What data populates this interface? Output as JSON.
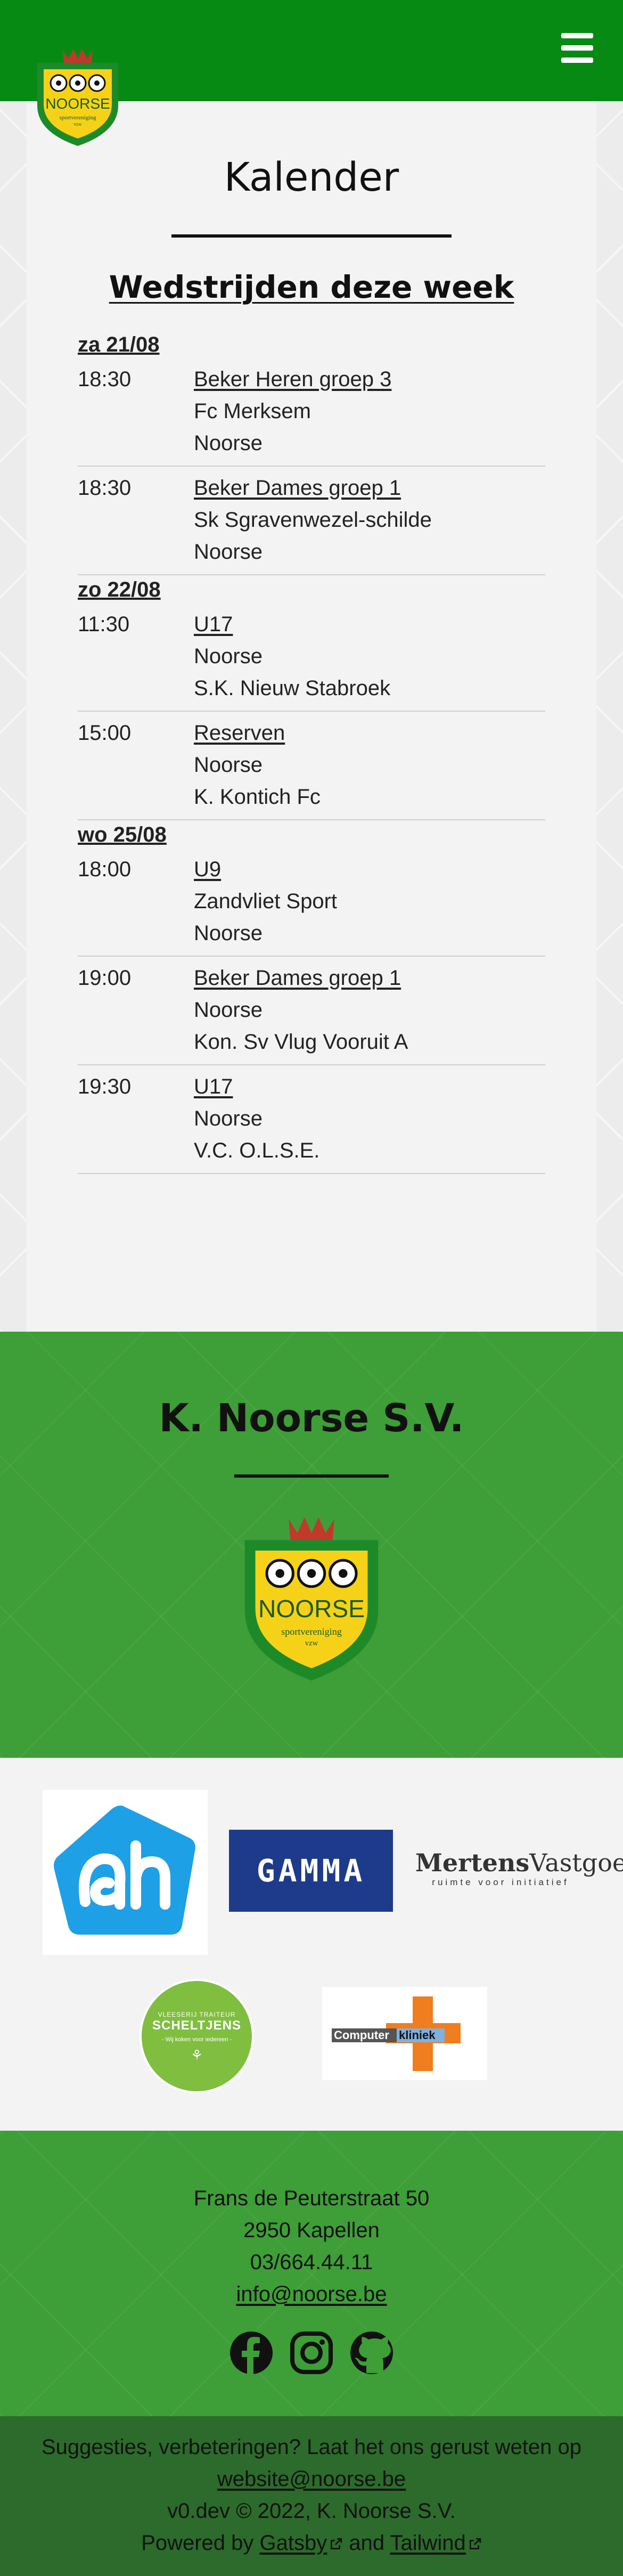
{
  "header": {
    "menu_icon": "hamburger-menu-icon",
    "logo_text": "NOORSE",
    "logo_subtext": "sportvereniging",
    "logo_subtext2": "vzw",
    "brand_color": "#078a14"
  },
  "main": {
    "title": "Kalender",
    "section_title": "Wedstrijden deze week",
    "days": [
      {
        "date": "za 21/08",
        "matches": [
          {
            "time": "18:30",
            "group": "Beker Heren groep 3",
            "home": "Fc Merksem",
            "away": "Noorse"
          },
          {
            "time": "18:30",
            "group": "Beker Dames groep 1",
            "home": "Sk Sgravenwezel-schilde",
            "away": "Noorse"
          }
        ]
      },
      {
        "date": "zo 22/08",
        "matches": [
          {
            "time": "11:30",
            "group": "U17",
            "home": "Noorse",
            "away": "S.K. Nieuw Stabroek"
          },
          {
            "time": "15:00",
            "group": "Reserven",
            "home": "Noorse",
            "away": "K. Kontich Fc"
          }
        ]
      },
      {
        "date": "wo 25/08",
        "matches": [
          {
            "time": "18:00",
            "group": "U9",
            "home": "Zandvliet Sport",
            "away": "Noorse"
          },
          {
            "time": "19:00",
            "group": "Beker Dames groep 1",
            "home": "Noorse",
            "away": "Kon. Sv Vlug Vooruit A"
          },
          {
            "time": "19:30",
            "group": "U17",
            "home": "Noorse",
            "away": "V.C. O.L.S.E."
          }
        ]
      }
    ]
  },
  "club": {
    "name": "K. Noorse S.V.",
    "logo_text": "NOORSE",
    "logo_subtext": "sportvereniging",
    "logo_subtext2": "vzw",
    "section_color": "#3e9e37"
  },
  "sponsors": {
    "gamma_label": "GAMMA",
    "mertens_bold": "Mertens",
    "mertens_rest": "Vastgoed",
    "mertens_tagline": "ruimte voor initiatief",
    "scheltjens_top": "VLEESERIJ TRAITEUR",
    "scheltjens_name": "SCHELTJENS",
    "scheltjens_tag": "- Wij koken voor iedereen -",
    "computer_label": "Computer",
    "computer_label2": "kliniek"
  },
  "contact": {
    "street": "Frans de Peuterstraat 50",
    "city": "2950 Kapellen",
    "phone": "03/664.44.11",
    "email": "info@noorse.be",
    "social_icons": [
      "facebook-icon",
      "instagram-icon",
      "github-icon"
    ]
  },
  "footer": {
    "suggest_text": "Suggesties, verbeteringen? Laat het ons gerust weten op",
    "suggest_email": "website@noorse.be",
    "version_text": "v0.dev © 2022, K. Noorse S.V.",
    "powered_prefix": "Powered by",
    "gatsby_link": "Gatsby",
    "and_text": "and",
    "tailwind_link": "Tailwind",
    "footer_color": "#2c6b2b"
  }
}
